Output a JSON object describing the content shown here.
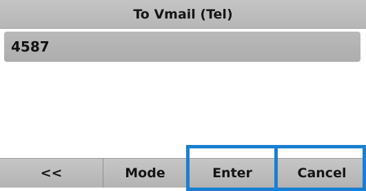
{
  "title": "To Vmail (Tel)",
  "entry": {
    "value": "4587"
  },
  "softkeys": [
    {
      "label": "<<"
    },
    {
      "label": "Mode"
    },
    {
      "label": "Enter"
    },
    {
      "label": "Cancel"
    }
  ],
  "highlight_color": "#1a7fd0"
}
